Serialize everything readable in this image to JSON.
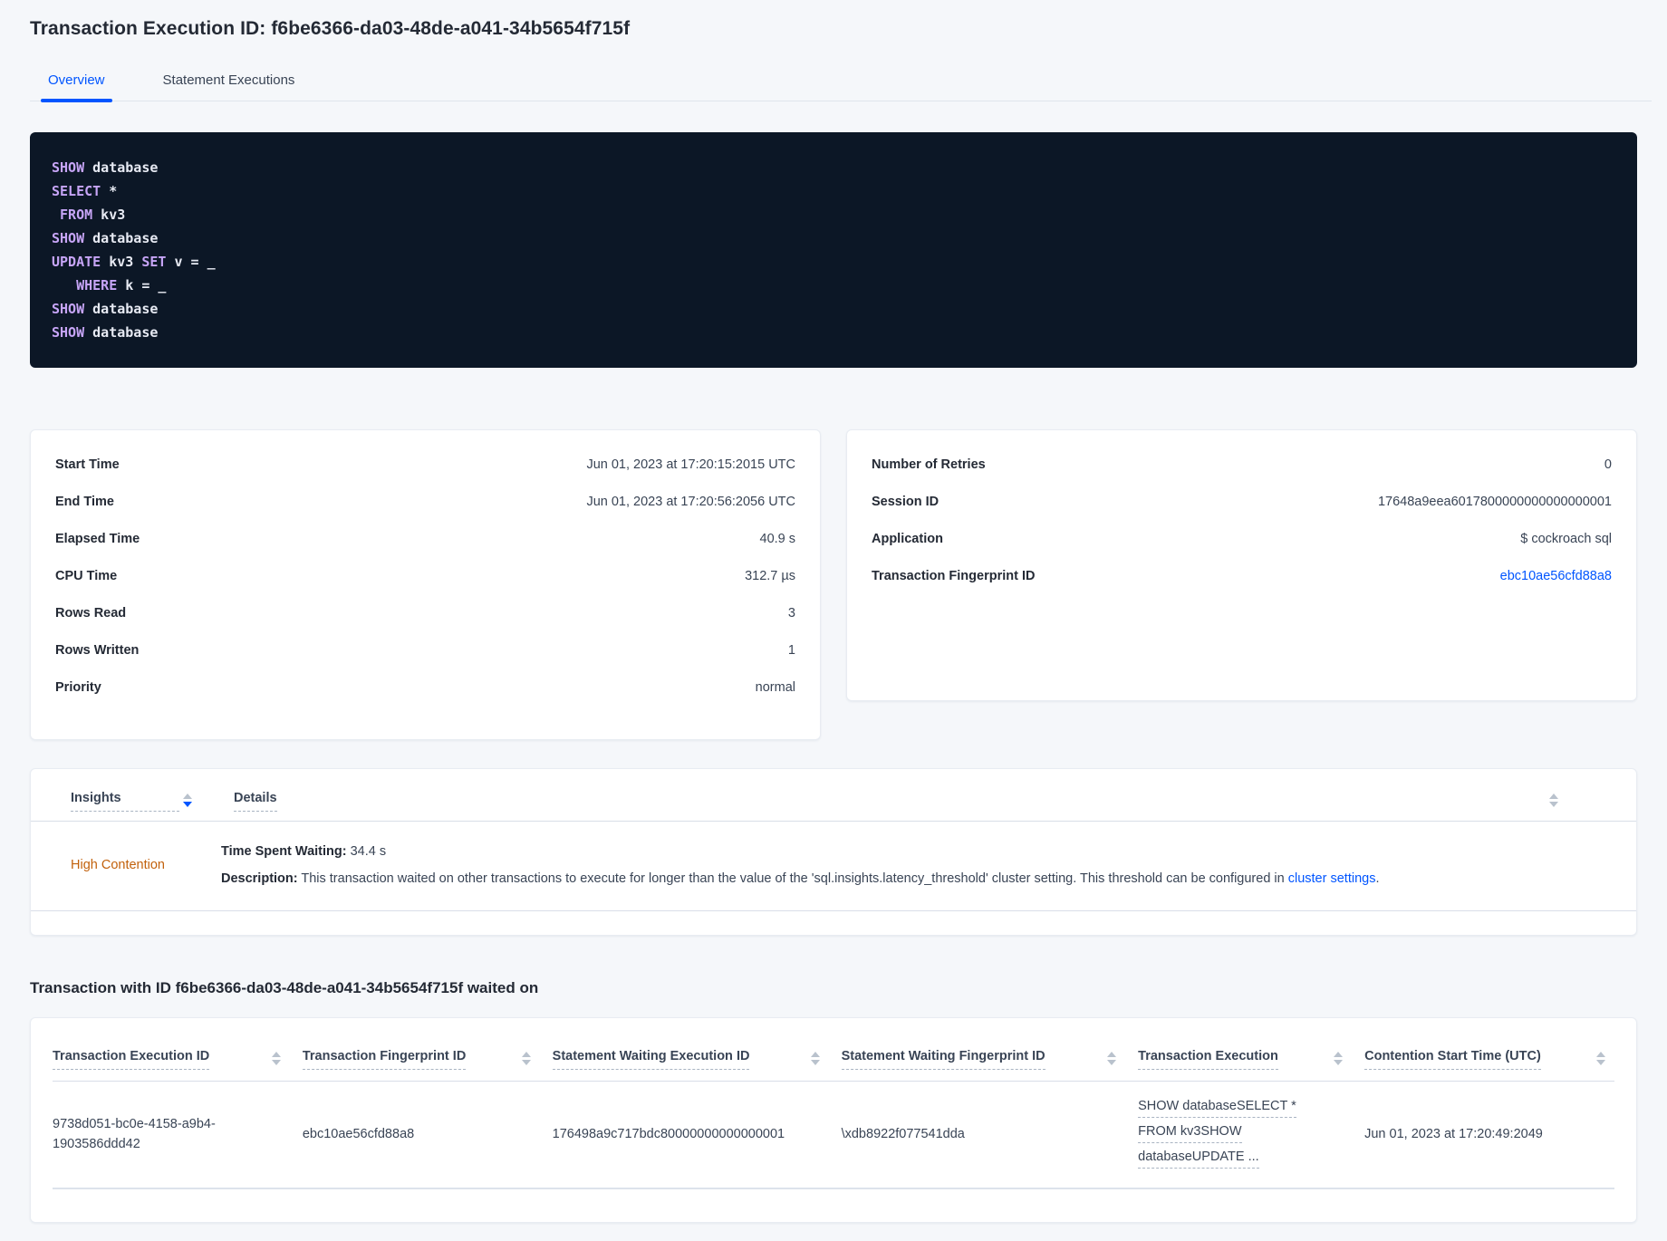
{
  "page": {
    "title": "Transaction Execution ID: f6be6366-da03-48de-a041-34b5654f715f"
  },
  "tabs": [
    {
      "label": "Overview",
      "active": true
    },
    {
      "label": "Statement Executions",
      "active": false
    }
  ],
  "sql": {
    "line1": {
      "kw": "SHOW",
      "rest": " database"
    },
    "line2": {
      "kw": "SELECT",
      "rest": " *"
    },
    "line3": {
      "pre": " ",
      "kw": "FROM",
      "rest": " kv3"
    },
    "line4": {
      "kw": "SHOW",
      "rest": " database"
    },
    "line5": {
      "kw1": "UPDATE",
      "mid": " kv3 ",
      "kw2": "SET",
      "rest": " v = _"
    },
    "line6": {
      "pre": "   ",
      "kw": "WHERE",
      "rest": " k = _"
    },
    "line7": {
      "kw": "SHOW",
      "rest": " database"
    },
    "line8": {
      "kw": "SHOW",
      "rest": " database"
    }
  },
  "left_card": {
    "rows": [
      {
        "label": "Start Time",
        "value": "Jun 01, 2023 at 17:20:15:2015 UTC"
      },
      {
        "label": "End Time",
        "value": "Jun 01, 2023 at 17:20:56:2056 UTC"
      },
      {
        "label": "Elapsed Time",
        "value": "40.9 s"
      },
      {
        "label": "CPU Time",
        "value": "312.7 µs"
      },
      {
        "label": "Rows Read",
        "value": "3"
      },
      {
        "label": "Rows Written",
        "value": "1"
      },
      {
        "label": "Priority",
        "value": "normal"
      }
    ]
  },
  "right_card": {
    "rows": [
      {
        "label": "Number of Retries",
        "value": "0"
      },
      {
        "label": "Session ID",
        "value": "17648a9eea6017800000000000000001"
      },
      {
        "label": "Application",
        "value": "$ cockroach sql"
      }
    ],
    "fingerprint_label": "Transaction Fingerprint ID",
    "fingerprint_value": "ebc10ae56cfd88a8"
  },
  "insights": {
    "col_insights": "Insights",
    "col_details": "Details",
    "row": {
      "insight": "High Contention",
      "waiting_label": "Time Spent Waiting:",
      "waiting_value": " 34.4 s",
      "desc_label": "Description:",
      "desc_text": " This transaction waited on other transactions to execute for longer than the value of the 'sql.insights.latency_threshold' cluster setting. This threshold can be configured in ",
      "desc_link": "cluster settings",
      "desc_end": "."
    }
  },
  "waited": {
    "heading": "Transaction with ID f6be6366-da03-48de-a041-34b5654f715f waited on",
    "columns": [
      "Transaction Execution ID",
      "Transaction Fingerprint ID",
      "Statement Waiting Execution ID",
      "Statement Waiting Fingerprint ID",
      "Transaction Execution",
      "Contention Start Time (UTC)"
    ],
    "row": {
      "txn_execution_id": "9738d051-bc0e-4158-a9b4-1903586ddd42",
      "txn_fingerprint_id": "ebc10ae56cfd88a8",
      "stmt_waiting_execution_id": "176498a9c717bdc80000000000000001",
      "stmt_waiting_fingerprint_id": "\\xdb8922f077541dda",
      "txn_execution_line1": "SHOW databaseSELECT *",
      "txn_execution_line2": "FROM kv3SHOW",
      "txn_execution_line3": "databaseUPDATE ...",
      "contention_start": "Jun 01, 2023 at 17:20:49:2049"
    }
  },
  "colors": {
    "accent_blue": "#0055ff",
    "insight_orange": "#c2610c",
    "code_background": "#0c1726",
    "code_keyword": "#c7a5f7",
    "code_text": "#e7eaf3",
    "page_background": "#f5f7fa"
  }
}
